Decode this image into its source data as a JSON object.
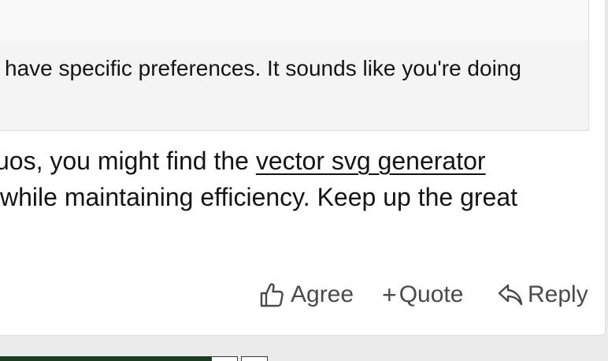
{
  "quote": {
    "text": "have specific preferences. It sounds like you're doing"
  },
  "post": {
    "line1_before": "uos, you might find the ",
    "link_text": "vector svg generator",
    "line2": "while maintaining efficiency. Keep up the great"
  },
  "actions": {
    "agree_label": "Agree",
    "quote_label": "Quote",
    "reply_label": "Reply",
    "quote_prefix": "+"
  },
  "icons": {
    "agree": "thumbs-up-icon",
    "quote": "plus-icon",
    "reply": "reply-arrow-icon"
  },
  "colors": {
    "footer_accent": "#1c3a22",
    "action_text": "#4a4a4a"
  }
}
